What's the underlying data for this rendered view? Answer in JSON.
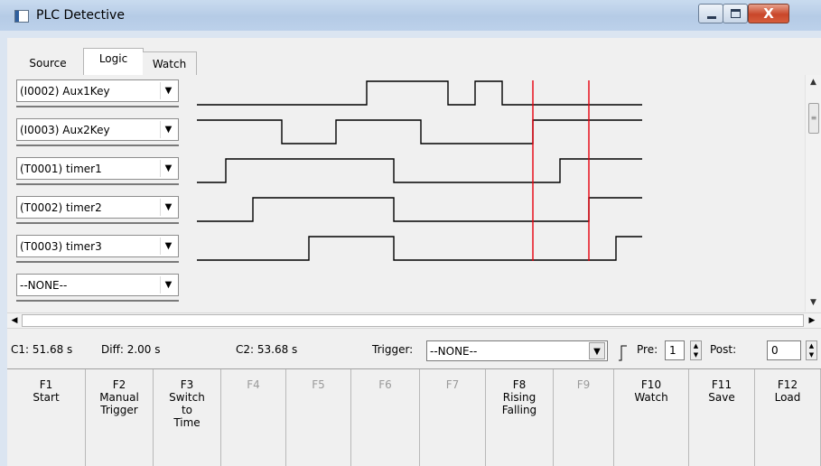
{
  "window": {
    "title": "PLC Detective",
    "min_icon": "minimize-icon",
    "max_icon": "maximize-icon",
    "close_glyph": "X"
  },
  "tabs": [
    {
      "label": "Source"
    },
    {
      "label": "Logic"
    },
    {
      "label": "Watch"
    }
  ],
  "channels": [
    {
      "label": "(I0002) Aux1Key"
    },
    {
      "label": "(I0003) Aux2Key"
    },
    {
      "label": "(T0001) timer1"
    },
    {
      "label": "(T0002) timer2"
    },
    {
      "label": "(T0003) timer3"
    },
    {
      "label": "--NONE--"
    }
  ],
  "signals": [
    {
      "initial": 0,
      "changes": [
        398,
        488,
        518,
        548
      ]
    },
    {
      "initial": 1,
      "changes": [
        304,
        364,
        458,
        582
      ]
    },
    {
      "initial": 0,
      "changes": [
        242,
        428,
        612
      ]
    },
    {
      "initial": 0,
      "changes": [
        272,
        428,
        644
      ]
    },
    {
      "initial": 0,
      "changes": [
        334,
        428,
        674
      ]
    }
  ],
  "signal_time_range": [
    210,
    703
  ],
  "cursor_positions": [
    582,
    644
  ],
  "colors": {
    "cursor": "#e8000e",
    "trace": "#000000",
    "close_button": "#c9472a"
  },
  "status": {
    "c1": "C1: 51.68 s",
    "diff": "Diff: 2.00 s",
    "c2": "C2: 53.68 s",
    "trigger_label": "Trigger:",
    "trigger_value": "--NONE--",
    "pre_label": "Pre:",
    "pre_value": "1",
    "post_label": "Post:",
    "post_value": "0"
  },
  "function_keys": [
    {
      "key": "F1",
      "label": "Start",
      "enabled": true
    },
    {
      "key": "F2",
      "label": "Manual Trigger",
      "enabled": true
    },
    {
      "key": "F3",
      "label": "Switch to Time",
      "enabled": true
    },
    {
      "key": "F4",
      "label": "",
      "enabled": false
    },
    {
      "key": "F5",
      "label": "",
      "enabled": false
    },
    {
      "key": "F6",
      "label": "",
      "enabled": false
    },
    {
      "key": "F7",
      "label": "",
      "enabled": false
    },
    {
      "key": "F8",
      "label": "Rising Falling",
      "enabled": true
    },
    {
      "key": "F9",
      "label": "",
      "enabled": false
    },
    {
      "key": "F10",
      "label": "Watch",
      "enabled": true
    },
    {
      "key": "F11",
      "label": "Save",
      "enabled": true
    },
    {
      "key": "F12",
      "label": "Load",
      "enabled": true
    }
  ]
}
